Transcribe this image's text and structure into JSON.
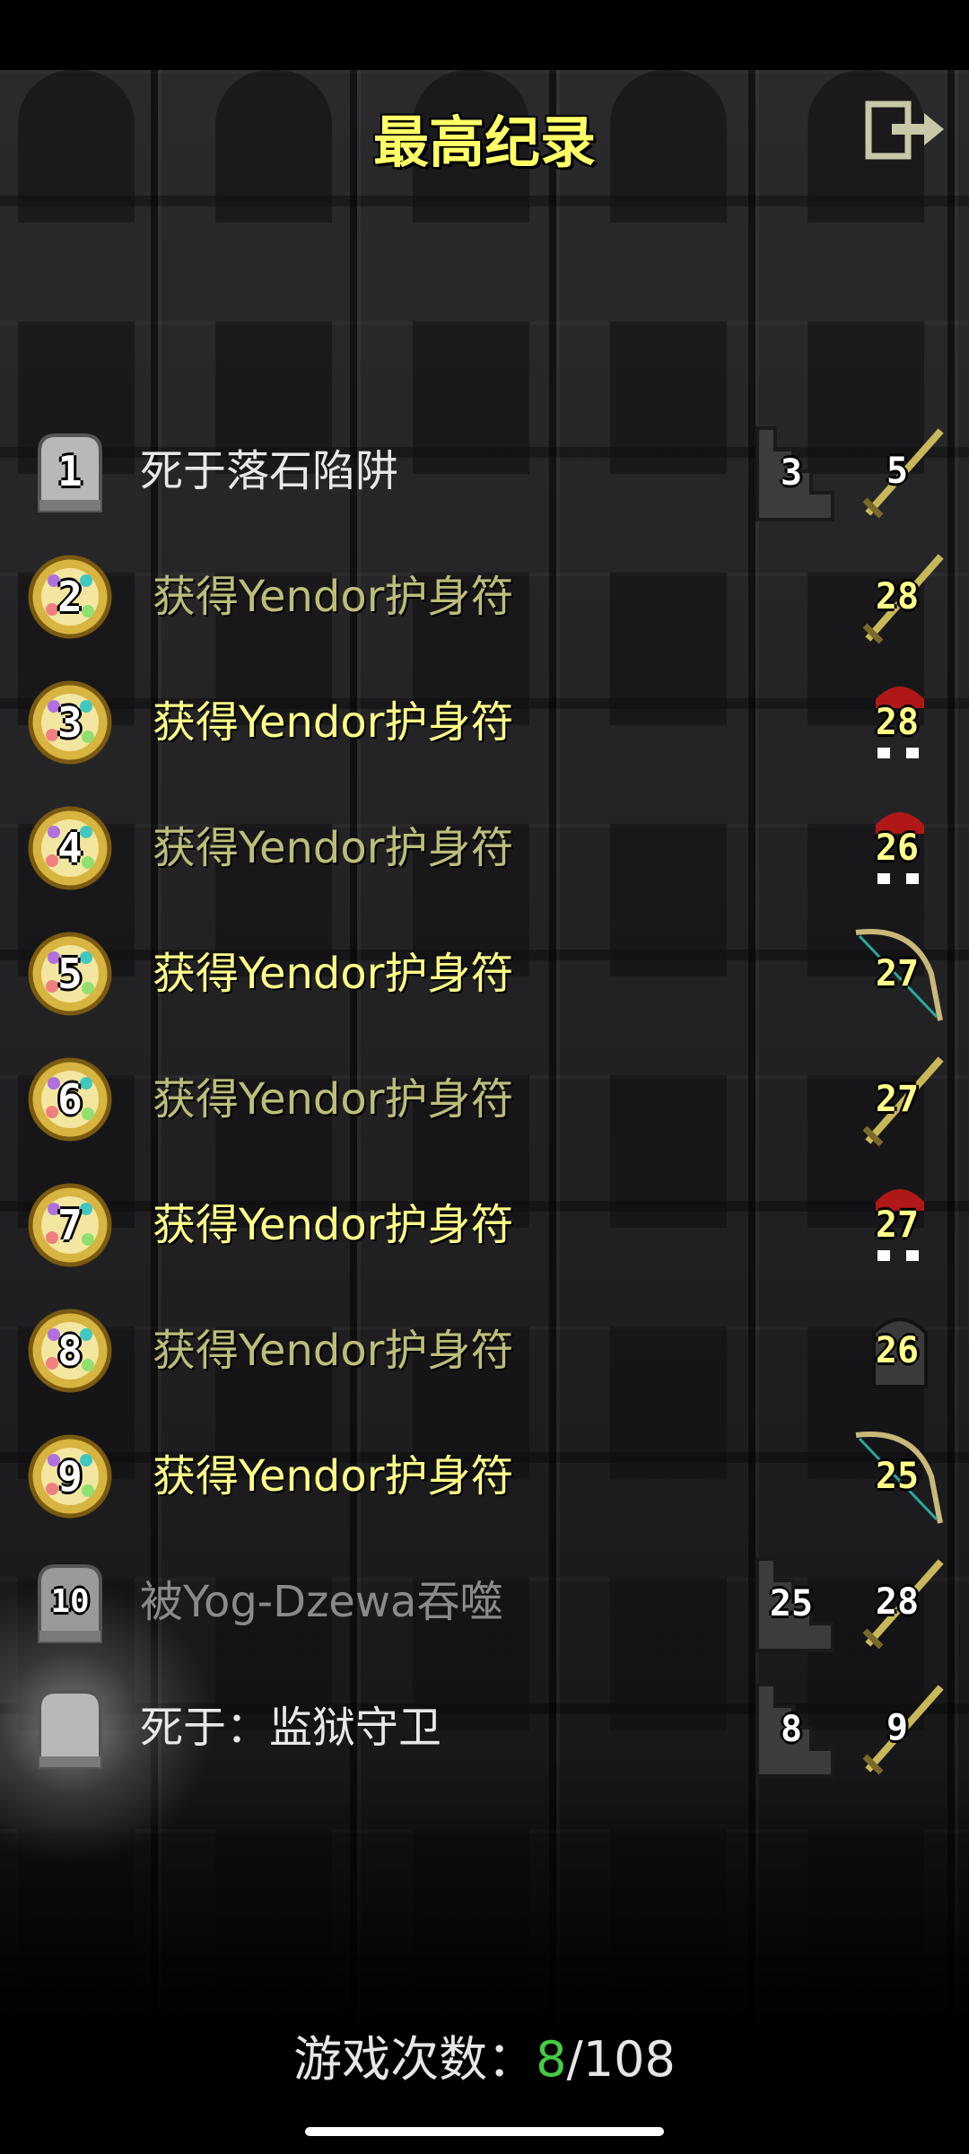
{
  "title": "最高纪录",
  "exit_icon": "exit-door-icon",
  "records": [
    {
      "rank": "1",
      "type": "death",
      "text": "死于落石陷阱",
      "depth": "3",
      "level": "5",
      "hero_icon": "sword-icon",
      "dim": false
    },
    {
      "rank": "2",
      "type": "win",
      "text": "获得Yendor护身符",
      "depth": "",
      "level": "28",
      "hero_icon": "sword-icon",
      "dim": true
    },
    {
      "rank": "3",
      "type": "win",
      "text": "获得Yendor护身符",
      "depth": "",
      "level": "28",
      "hero_icon": "red-hood-icon",
      "dim": false
    },
    {
      "rank": "4",
      "type": "win",
      "text": "获得Yendor护身符",
      "depth": "",
      "level": "26",
      "hero_icon": "red-hood-icon",
      "dim": true
    },
    {
      "rank": "5",
      "type": "win",
      "text": "获得Yendor护身符",
      "depth": "",
      "level": "27",
      "hero_icon": "bow-icon",
      "dim": false
    },
    {
      "rank": "6",
      "type": "win",
      "text": "获得Yendor护身符",
      "depth": "",
      "level": "27",
      "hero_icon": "sword-icon",
      "dim": true
    },
    {
      "rank": "7",
      "type": "win",
      "text": "获得Yendor护身符",
      "depth": "",
      "level": "27",
      "hero_icon": "red-hood-icon",
      "dim": false
    },
    {
      "rank": "8",
      "type": "win",
      "text": "获得Yendor护身符",
      "depth": "",
      "level": "26",
      "hero_icon": "dark-hood-icon",
      "dim": true
    },
    {
      "rank": "9",
      "type": "win",
      "text": "获得Yendor护身符",
      "depth": "",
      "level": "25",
      "hero_icon": "bow-icon",
      "dim": false
    },
    {
      "rank": "10",
      "type": "death",
      "text": "被Yog-Dzewa吞噬",
      "depth": "25",
      "level": "28",
      "hero_icon": "sword-icon",
      "dim": true
    },
    {
      "rank": "",
      "type": "death-latest",
      "text": "死于：监狱守卫",
      "depth": "8",
      "level": "9",
      "hero_icon": "sword-icon",
      "dim": false
    }
  ],
  "footer": {
    "label": "游戏次数：",
    "won": "8",
    "separator": "/",
    "total": "108"
  },
  "colors": {
    "title": "#ffff66",
    "win_text": "#ffff88",
    "won_count": "#44cc44"
  }
}
